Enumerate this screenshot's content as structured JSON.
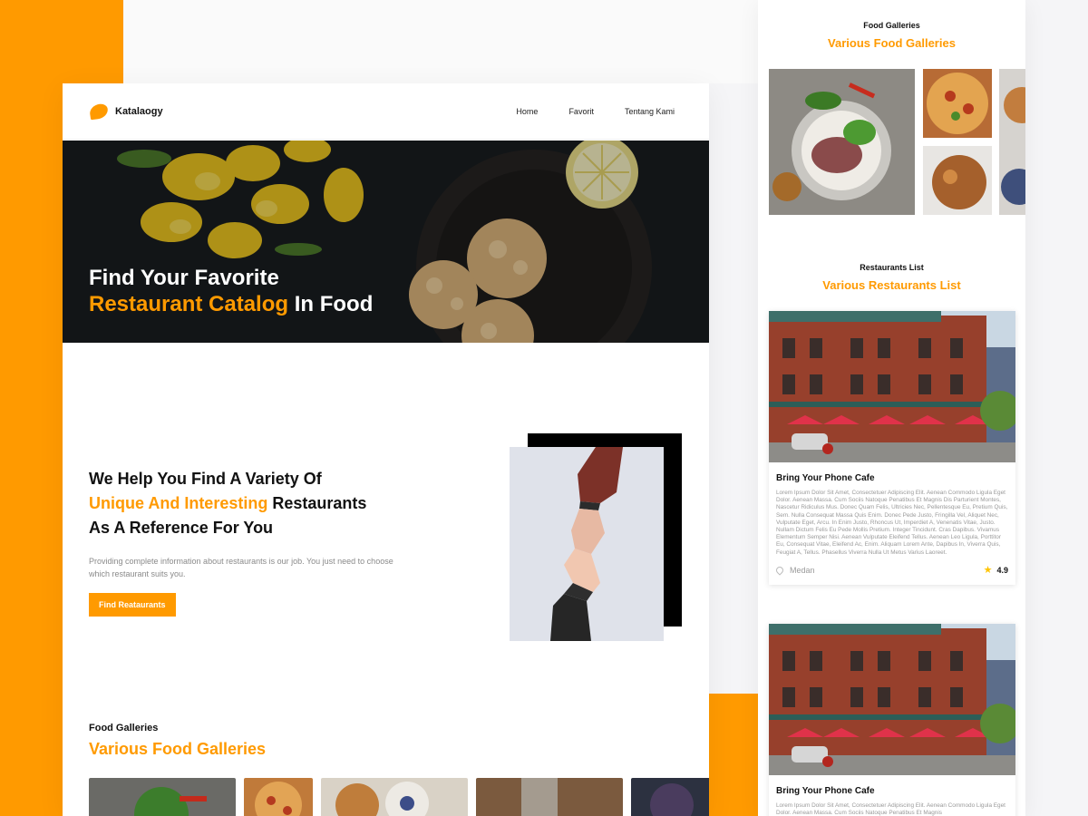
{
  "desktop": {
    "brand": "Katalaogy",
    "nav": [
      "Home",
      "Favorit",
      "Tentang Kami"
    ],
    "hero": {
      "line1": "Find Your Favorite",
      "line2_accent": "Restaurant Catalog",
      "line2_rest": " In Food"
    },
    "help": {
      "line1": "We Help You Find A Variety Of",
      "line2_accent": "Unique And Interesting",
      "line2_rest": " Restaurants",
      "line3": "As A Reference For You",
      "desc": "Providing complete information about restaurants is our job. You just need to choose which restaurant suits you.",
      "button": "Find Reataurants"
    },
    "gallery": {
      "small": "Food Galleries",
      "big": "Various Food Galleries"
    }
  },
  "mobile": {
    "gallery": {
      "small": "Food Galleries",
      "big": "Various Food Galleries"
    },
    "restaurants": {
      "small": "Restaurants List",
      "big": "Various Restaurants List"
    },
    "cards": [
      {
        "title": "Bring Your Phone Cafe",
        "desc": "Lorem Ipsum Dolor Sit Amet, Consectetuer Adipiscing Elit. Aenean Commodo Ligula Eget Dolor. Aenean Massa. Cum Sociis Natoque Penatibus Et Magnis Dis Parturient Montes, Nascetur Ridiculus Mus. Donec Quam Felis, Ultricies Nec, Pellentesque Eu, Pretium Quis, Sem. Nulla Consequat Massa Quis Enim. Donec Pede Justo, Fringilla Vel, Aliquet Nec, Vulputate Eget, Arcu. In Enim Justo, Rhoncus Ut, Imperdiet A, Venenatis Vitae, Justo. Nullam Dictum Felis Eu Pede Mollis Pretium. Integer Tincidunt. Cras Dapibus. Vivamus Elementum Semper Nisi. Aenean Vulputate Eleifend Tellus. Aenean Leo Ligula, Porttitor Eu, Consequat Vitae, Eleifend Ac, Enim. Aliquam Lorem Ante, Dapibus In, Viverra Quis, Feugiat A, Tellus. Phasellus Viverra Nulla Ut Metus Varius Laoreet.",
        "city": "Medan",
        "rating": "4.9"
      },
      {
        "title": "Bring Your Phone Cafe",
        "desc": "Lorem Ipsum Dolor Sit Amet, Consectetuer Adipiscing Elit. Aenean Commodo Ligula Eget Dolor. Aenean Massa. Cum Sociis Natoque Penatibus Et Magnis"
      }
    ]
  },
  "colors": {
    "accent": "#ff9a00",
    "dark": "#111111",
    "muted": "#9a9a9a"
  }
}
